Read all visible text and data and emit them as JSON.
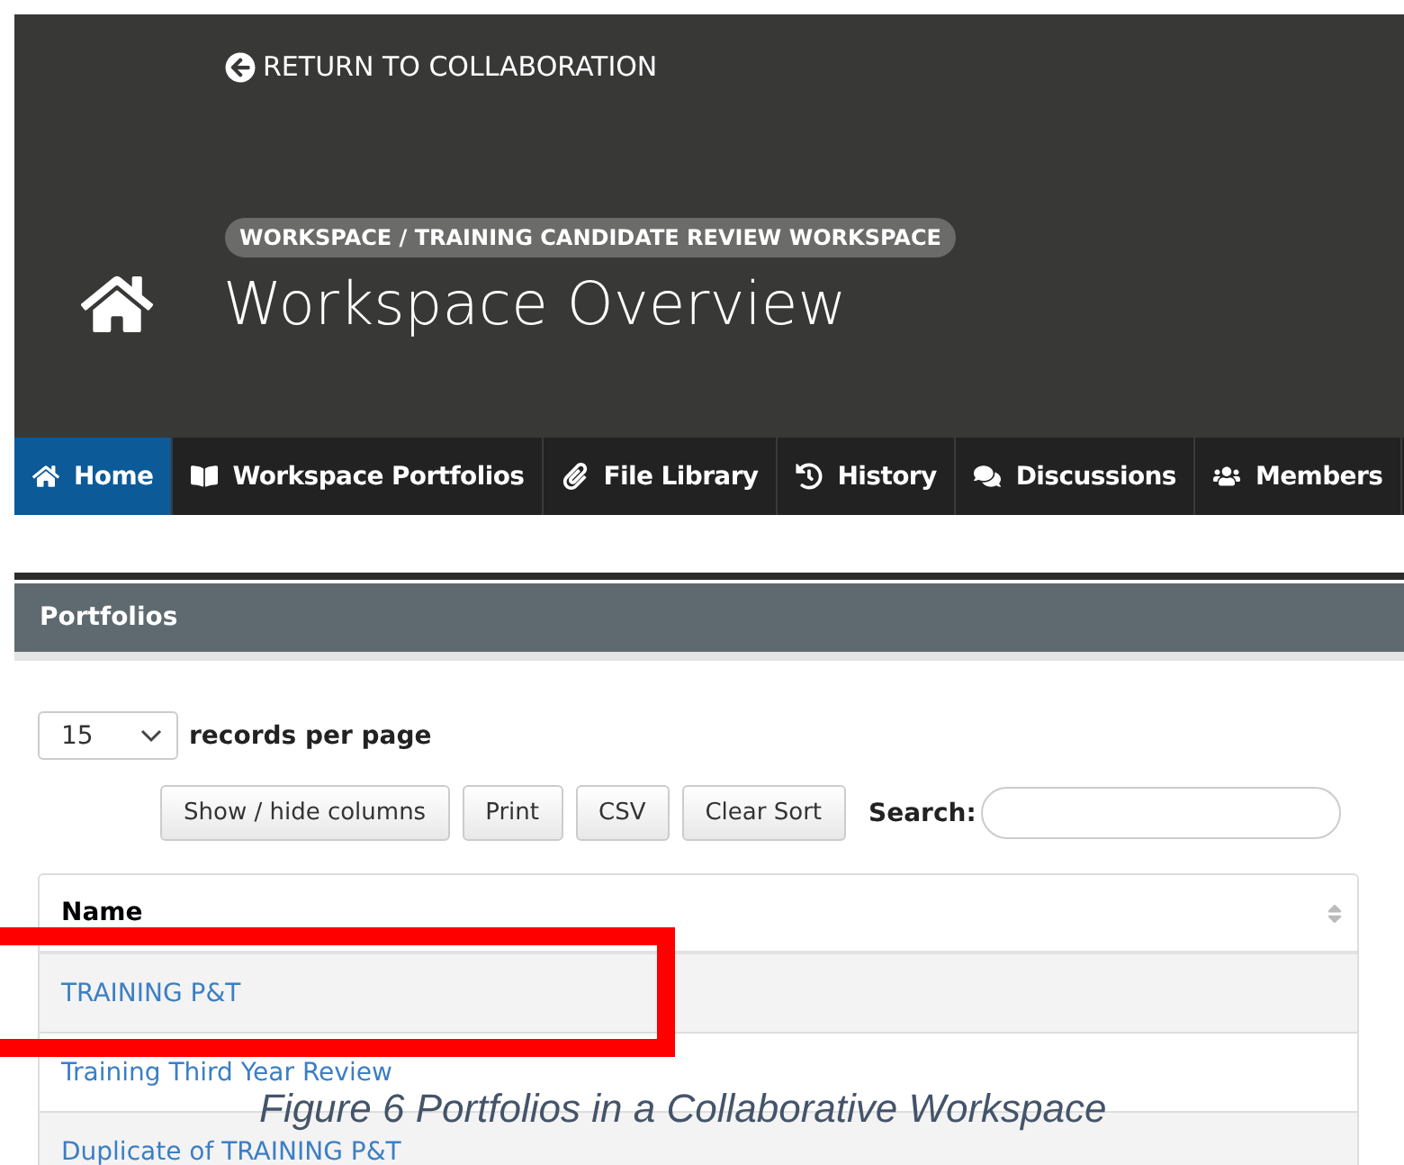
{
  "header": {
    "return_link": "RETURN TO COLLABORATION",
    "breadcrumb": "WORKSPACE / TRAINING CANDIDATE REVIEW WORKSPACE",
    "title": "Workspace Overview"
  },
  "nav": [
    {
      "label": "Home",
      "selected": true
    },
    {
      "label": "Workspace Portfolios",
      "selected": false
    },
    {
      "label": "File Library",
      "selected": false
    },
    {
      "label": "History",
      "selected": false
    },
    {
      "label": "Discussions",
      "selected": false
    },
    {
      "label": "Members",
      "selected": false
    }
  ],
  "panel": {
    "title": "Portfolios",
    "page_size": "15",
    "page_size_label": "records per page",
    "buttons": [
      "Show / hide columns",
      "Print",
      "CSV",
      "Clear Sort"
    ],
    "search_label": "Search:"
  },
  "table": {
    "columns": [
      "Name"
    ],
    "rows": [
      "TRAINING P&T",
      "Training Third Year Review",
      "Duplicate of TRAINING P&T"
    ]
  },
  "caption": "Figure 6 Portfolios in a Collaborative Workspace"
}
